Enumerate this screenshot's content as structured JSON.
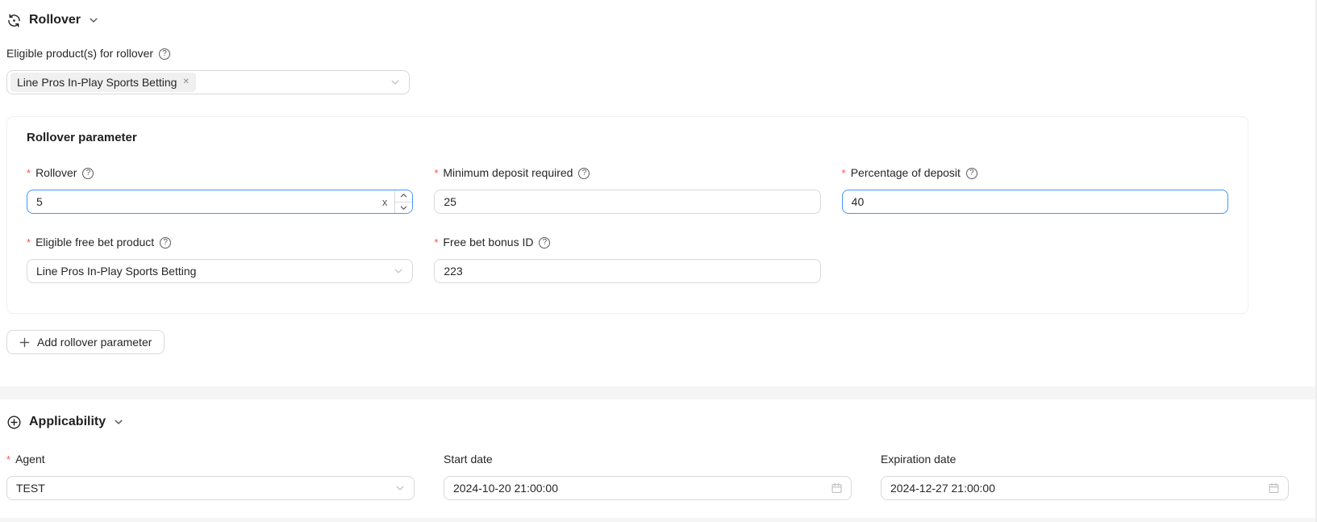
{
  "colors": {
    "focus_blue": "#4096ff",
    "required_red": "#ff4d4f",
    "border_gray": "#d9d9d9",
    "divider_gray": "#f5f5f5"
  },
  "icons": {
    "help": "?",
    "close": "✕"
  },
  "rollover": {
    "title": "Rollover",
    "eligible_products": {
      "label": "Eligible product(s) for rollover",
      "selected_tags": [
        "Line Pros In-Play Sports Betting"
      ]
    },
    "card": {
      "title": "Rollover parameter",
      "rollover_field": {
        "label": "Rollover",
        "value": "5",
        "suffix": "x"
      },
      "min_deposit_field": {
        "label": "Minimum deposit required",
        "value": "25"
      },
      "percentage_field": {
        "label": "Percentage of deposit",
        "value": "40"
      },
      "free_bet_product_field": {
        "label": "Eligible free bet product",
        "value": "Line Pros In-Play Sports Betting"
      },
      "free_bet_bonus_field": {
        "label": "Free bet bonus ID",
        "value": "223"
      }
    },
    "add_button_label": "Add rollover parameter"
  },
  "applicability": {
    "title": "Applicability",
    "agent_field": {
      "label": "Agent",
      "value": "TEST"
    },
    "start_date_field": {
      "label": "Start date",
      "value": "2024-10-20 21:00:00"
    },
    "expiration_date_field": {
      "label": "Expiration date",
      "value": "2024-12-27 21:00:00"
    }
  }
}
